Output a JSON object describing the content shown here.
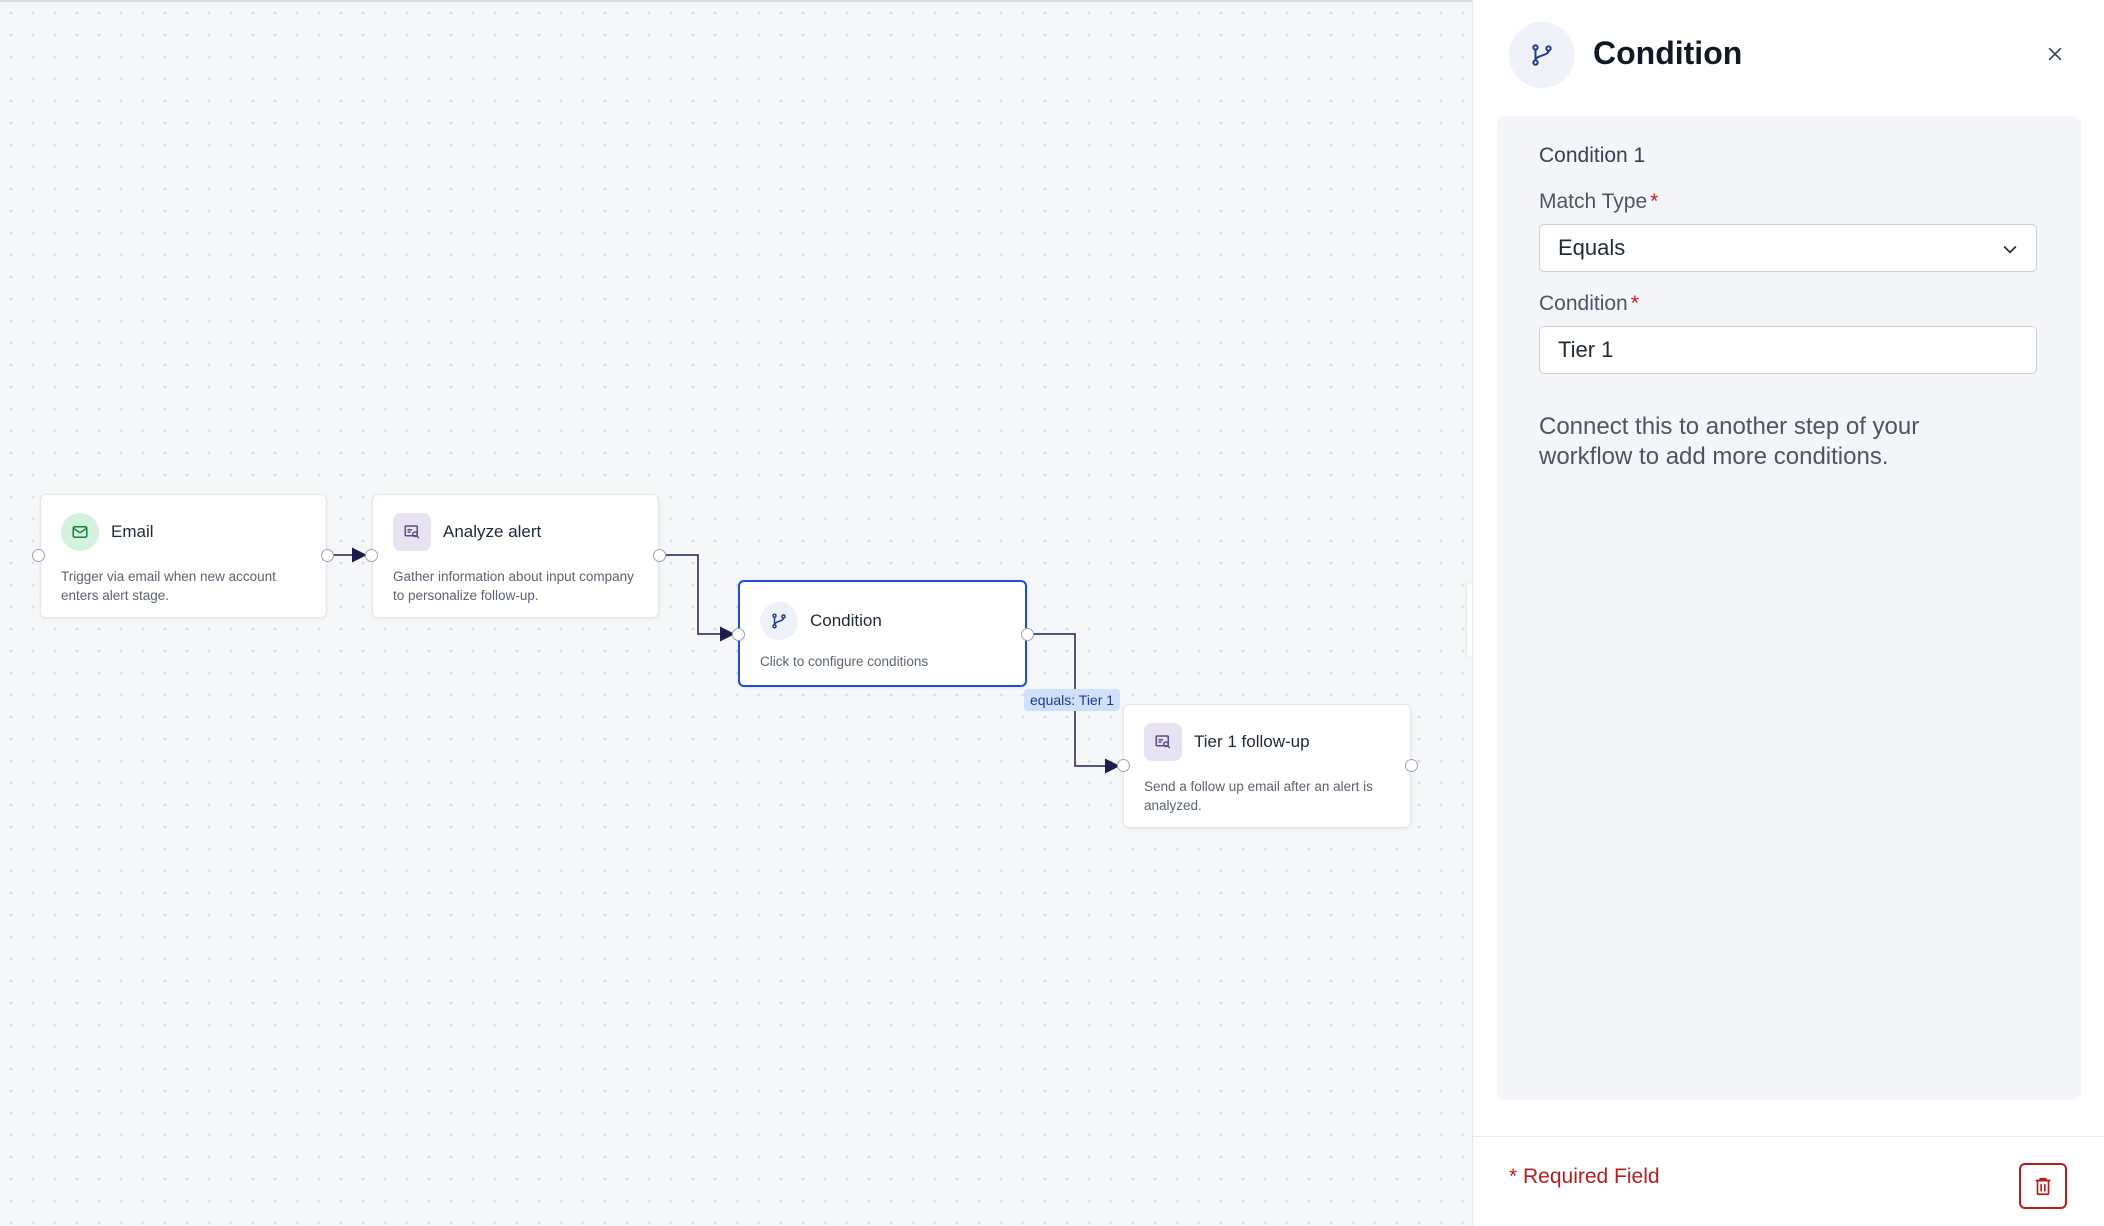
{
  "canvas": {
    "nodes": [
      {
        "id": "email",
        "title": "Email",
        "description": "Trigger via email when new account enters alert stage.",
        "icon": "mail-icon"
      },
      {
        "id": "analyze",
        "title": "Analyze alert",
        "description": "Gather information about input company to personalize follow-up.",
        "icon": "analyze-icon"
      },
      {
        "id": "condition",
        "title": "Condition",
        "description": "Click to configure conditions",
        "icon": "branch-icon"
      },
      {
        "id": "tier1",
        "title": "Tier 1 follow-up",
        "description": "Send a follow up email after an alert is analyzed.",
        "icon": "analyze-icon"
      }
    ],
    "edge_label": "equals: Tier 1"
  },
  "panel": {
    "title": "Condition",
    "icon": "branch-icon",
    "section_title": "Condition 1",
    "match_type": {
      "label": "Match Type",
      "required_mark": "*",
      "value": "Equals"
    },
    "condition": {
      "label": "Condition",
      "required_mark": "*",
      "value": "Tier 1"
    },
    "hint": "Connect this to another step of your workflow to add more conditions.",
    "footer": {
      "required_note": "* Required Field"
    }
  },
  "colors": {
    "accent": "#1d4ed8",
    "required": "#b91c1c",
    "edge": "#1f1d4e"
  }
}
